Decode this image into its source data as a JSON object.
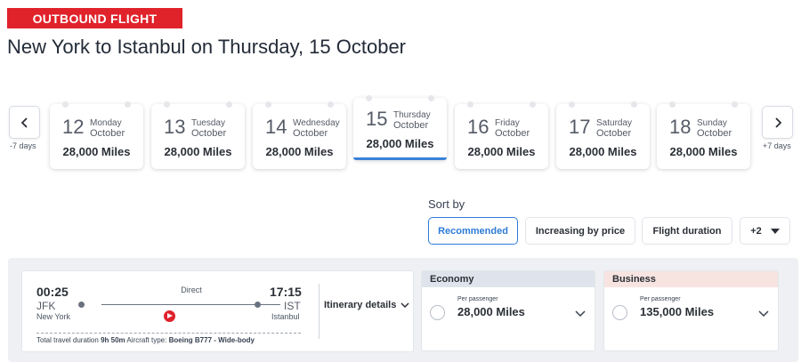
{
  "header": {
    "badge": "OUTBOUND FLIGHT",
    "title": "New York to Istanbul on Thursday, 15 October"
  },
  "date_nav": {
    "prev_label": "-7 days",
    "next_label": "+7 days",
    "selected_underline_color": "#3b82d8",
    "dates": [
      {
        "day": "12",
        "weekday": "Monday",
        "month": "October",
        "miles": "28,000 Miles"
      },
      {
        "day": "13",
        "weekday": "Tuesday",
        "month": "October",
        "miles": "28,000 Miles"
      },
      {
        "day": "14",
        "weekday": "Wednesday",
        "month": "October",
        "miles": "28,000 Miles"
      },
      {
        "day": "15",
        "weekday": "Thursday",
        "month": "October",
        "miles": "28,000 Miles",
        "selected": true
      },
      {
        "day": "16",
        "weekday": "Friday",
        "month": "October",
        "miles": "28,000 Miles"
      },
      {
        "day": "17",
        "weekday": "Saturday",
        "month": "October",
        "miles": "28,000 Miles"
      },
      {
        "day": "18",
        "weekday": "Sunday",
        "month": "October",
        "miles": "28,000 Miles"
      }
    ]
  },
  "sort": {
    "label": "Sort by",
    "options": [
      "Recommended",
      "Increasing by price",
      "Flight duration"
    ],
    "active": "Recommended",
    "more": "+2"
  },
  "flight": {
    "depart_time": "00:25",
    "depart_code": "JFK",
    "depart_city": "New York",
    "arrive_time": "17:15",
    "arrive_code": "IST",
    "arrive_city": "Istanbul",
    "stops": "Direct",
    "duration_label": "Total travel duration",
    "duration": "9h 50m",
    "aircraft_label": "Aircraft type:",
    "aircraft": "Boeing B777 - Wide-body",
    "itinerary_link": "Itinerary details",
    "airline_logo_color": "#e0222b"
  },
  "cabins": {
    "economy": {
      "name": "Economy",
      "per": "Per passenger",
      "miles": "28,000 Miles",
      "head_color": "#dfe4ec"
    },
    "business": {
      "name": "Business",
      "per": "Per passenger",
      "miles": "135,000 Miles",
      "head_color": "#f7e4e0"
    }
  },
  "colors": {
    "brand_red": "#e0222b",
    "accent_blue": "#2e7bd6"
  }
}
